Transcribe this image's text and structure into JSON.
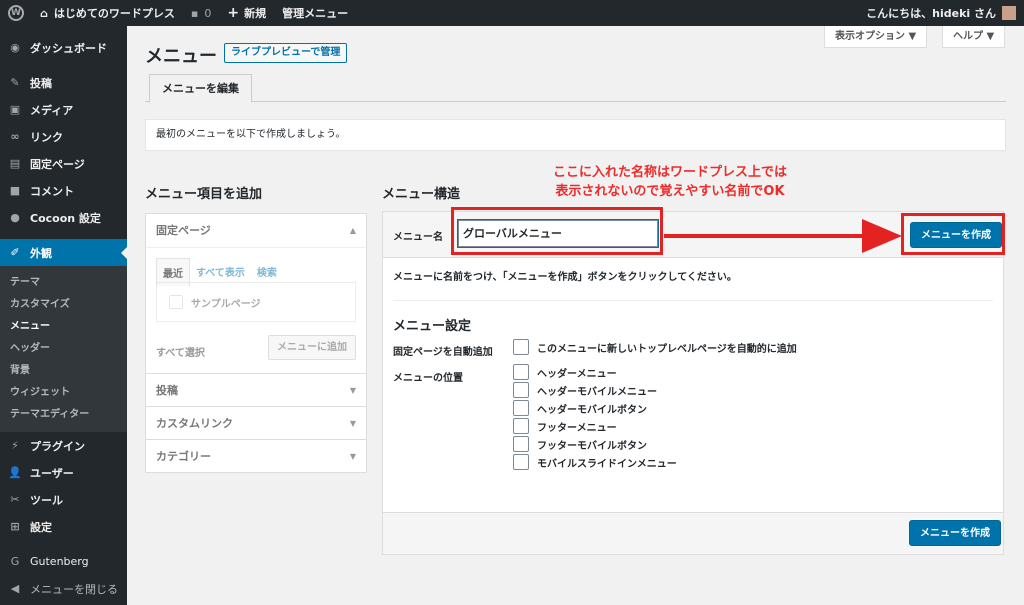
{
  "adminbar": {
    "site_name": "はじめてのワードプレス",
    "comments_count": "0",
    "new_label": "新規",
    "manage_menu_label": "管理メニュー",
    "greeting": "こんにちは、hideki さん"
  },
  "sidebar": {
    "items": [
      {
        "label": "ダッシュボード",
        "icon": "dashboard-icon"
      },
      {
        "label": "投稿",
        "icon": "pin-icon"
      },
      {
        "label": "メディア",
        "icon": "media-icon"
      },
      {
        "label": "リンク",
        "icon": "link-icon"
      },
      {
        "label": "固定ページ",
        "icon": "page-icon"
      },
      {
        "label": "コメント",
        "icon": "comment-icon"
      },
      {
        "label": "Cocoon 設定",
        "icon": "cocoon-icon"
      },
      {
        "label": "外観",
        "icon": "brush-icon"
      }
    ],
    "submenu": [
      "テーマ",
      "カスタマイズ",
      "メニュー",
      "ヘッダー",
      "背景",
      "ウィジェット",
      "テーマエディター"
    ],
    "items2": [
      {
        "label": "プラグイン",
        "icon": "plugin-icon"
      },
      {
        "label": "ユーザー",
        "icon": "user-icon"
      },
      {
        "label": "ツール",
        "icon": "wrench-icon"
      },
      {
        "label": "設定",
        "icon": "settings-icon"
      }
    ],
    "gutenberg": "Gutenberg",
    "collapse": "メニューを閉じる"
  },
  "header": {
    "title": "メニュー",
    "live_preview": "ライブプレビューで管理",
    "screen_options": "表示オプション ▼",
    "help": "ヘルプ ▼"
  },
  "tab": "メニューを編集",
  "notice": "最初のメニューを以下で作成しましょう。",
  "left": {
    "heading": "メニュー項目を追加",
    "fixed_pages": "固定ページ",
    "mini_tabs": [
      "最近",
      "すべて表示",
      "検索"
    ],
    "sample_page": "サンプルページ",
    "select_all": "すべて選択",
    "add_to_menu": "メニューに追加",
    "sections": [
      "投稿",
      "カスタムリンク",
      "カテゴリー"
    ]
  },
  "right": {
    "heading": "メニュー構造",
    "name_label": "メニュー名",
    "name_value": "グローバルメニュー",
    "create_button": "メニューを作成",
    "hint": "メニューに名前をつけ、「メニューを作成」ボタンをクリックしてください。",
    "settings_heading": "メニュー設定",
    "auto_add_label": "固定ページを自動追加",
    "auto_add_option": "このメニューに新しいトップレベルページを自動的に追加",
    "location_label": "メニューの位置",
    "locations": [
      "ヘッダーメニュー",
      "ヘッダーモバイルメニュー",
      "ヘッダーモバイルボタン",
      "フッターメニュー",
      "フッターモバイルボタン",
      "モバイルスライドインメニュー"
    ]
  },
  "annotation": {
    "line1": "ここに入れた名称はワードプレス上では",
    "line2": "表示されないので覚えやすい名前でOK"
  },
  "colors": {
    "accent": "#0073aa",
    "annotation": "#e52222",
    "sidebar": "#23282d"
  }
}
